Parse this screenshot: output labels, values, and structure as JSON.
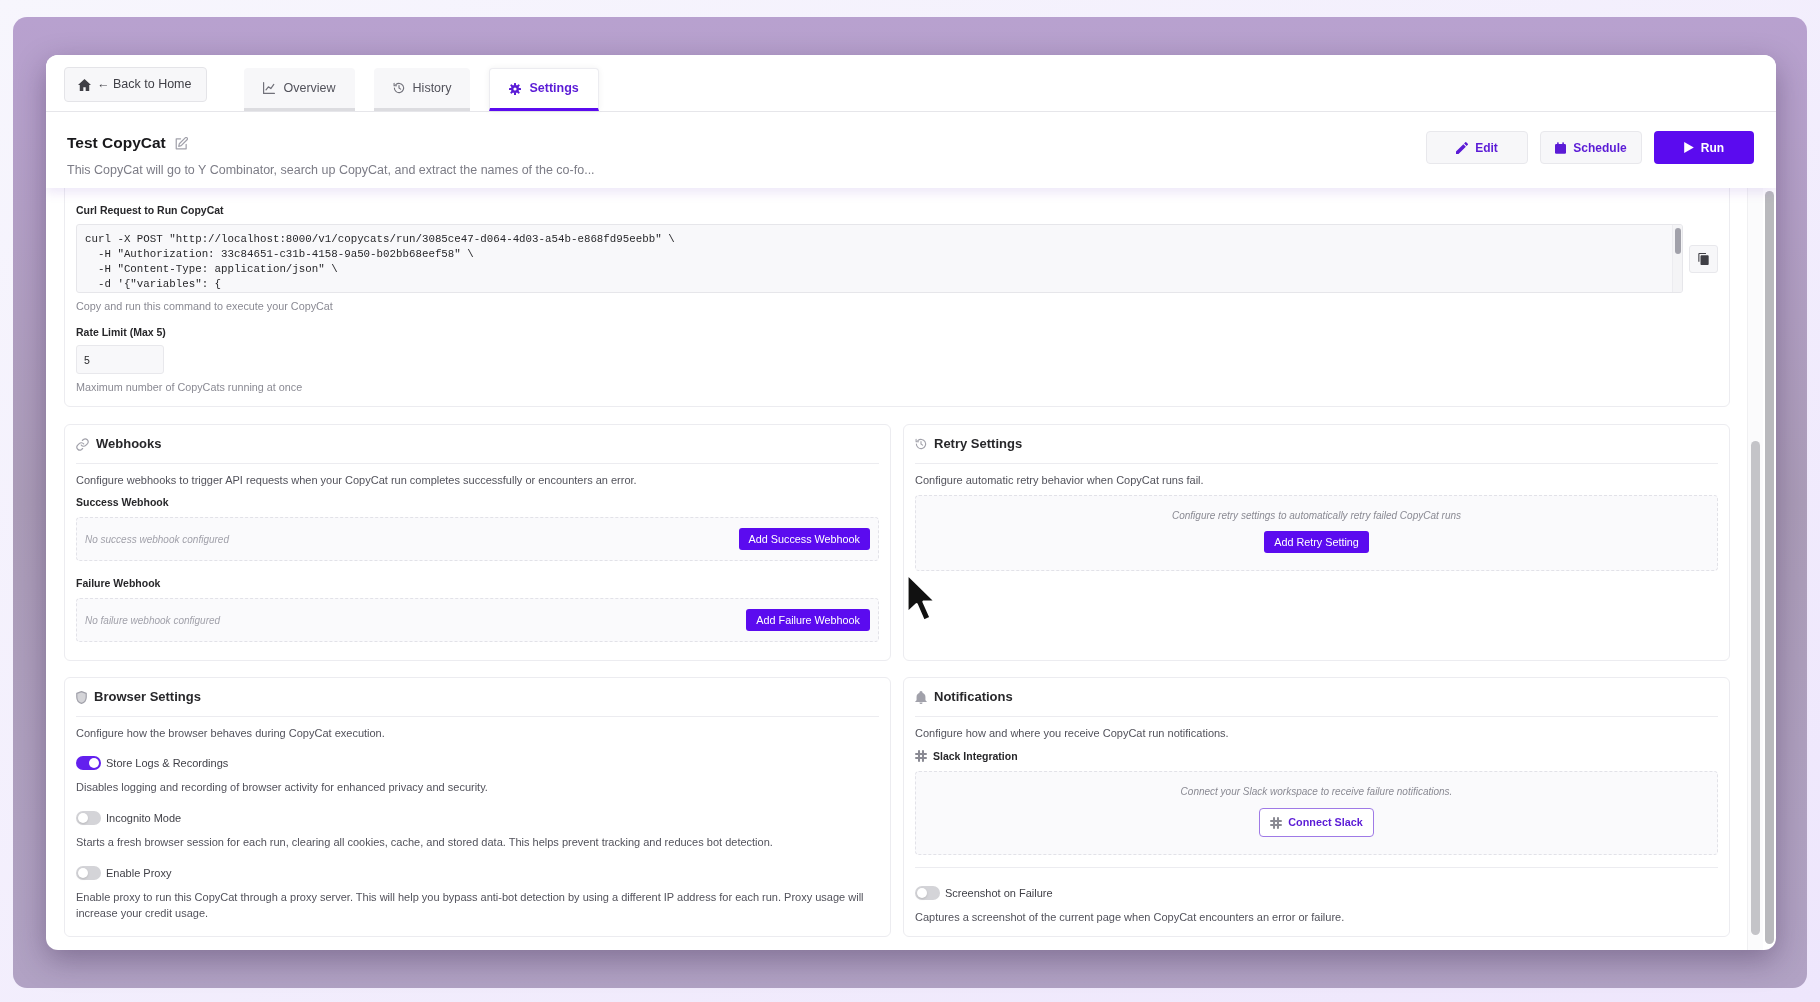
{
  "nav": {
    "back_label": "← Back to Home",
    "tabs": [
      {
        "label": "Overview",
        "selected": false
      },
      {
        "label": "History",
        "selected": false
      },
      {
        "label": "Settings",
        "selected": true
      }
    ]
  },
  "header": {
    "title": "Test CopyCat",
    "description": "This CopyCat will go to Y Combinator, search up CopyCat, and extract the names of the co-fo...",
    "actions": [
      {
        "label": "Edit",
        "kind": "secondary"
      },
      {
        "label": "Schedule",
        "kind": "secondary"
      },
      {
        "label": "Run",
        "kind": "primary"
      }
    ]
  },
  "api": {
    "curl_label": "Curl Request to Run CopyCat",
    "curl_command": [
      "curl -X POST \"http://localhost:8000/v1/copycats/run/3085ce47-d064-4d03-a54b-e868fd95eebb\" \\",
      "  -H \"Authorization: 33c84651-c31b-4158-9a50-b02bb68eef58\" \\",
      "  -H \"Content-Type: application/json\" \\",
      "  -d '{\"variables\": {"
    ],
    "curl_hint": "Copy and run this command to execute your CopyCat",
    "rate_limit_label": "Rate Limit (Max 5)",
    "rate_limit_value": "5",
    "rate_limit_hint": "Maximum number of CopyCats running at once"
  },
  "webhooks": {
    "title": "Webhooks",
    "description": "Configure webhooks to trigger API requests when your CopyCat run completes successfully or encounters an error.",
    "items": [
      {
        "label": "Success Webhook",
        "empty_text": "No success webhook configured",
        "button": "Add Success Webhook"
      },
      {
        "label": "Failure Webhook",
        "empty_text": "No failure webhook configured",
        "button": "Add Failure Webhook"
      }
    ]
  },
  "retry": {
    "title": "Retry Settings",
    "description": "Configure automatic retry behavior when CopyCat runs fail.",
    "empty_text": "Configure retry settings to automatically retry failed CopyCat runs",
    "button": "Add Retry Setting"
  },
  "browser_settings": {
    "title": "Browser Settings",
    "description": "Configure how the browser behaves during CopyCat execution.",
    "options": [
      {
        "label": "Store Logs & Recordings",
        "on": true,
        "hint": "Disables logging and recording of browser activity for enhanced privacy and security."
      },
      {
        "label": "Incognito Mode",
        "on": false,
        "hint": "Starts a fresh browser session for each run, clearing all cookies, cache, and stored data. This helps prevent tracking and reduces bot detection."
      },
      {
        "label": "Enable Proxy",
        "on": false,
        "hint": "Enable proxy to run this CopyCat through a proxy server. This will help you bypass anti-bot detection by using a different IP address for each run. Proxy usage will increase your credit usage."
      }
    ]
  },
  "notifications": {
    "title": "Notifications",
    "description": "Configure how and where you receive CopyCat run notifications.",
    "slack": {
      "label": "Slack Integration",
      "empty_text": "Connect your Slack workspace to receive failure notifications.",
      "button": "Connect Slack"
    },
    "options": [
      {
        "label": "Screenshot on Failure",
        "on": false,
        "hint": "Captures a screenshot of the current page when CopyCat encounters an error or failure."
      }
    ]
  }
}
